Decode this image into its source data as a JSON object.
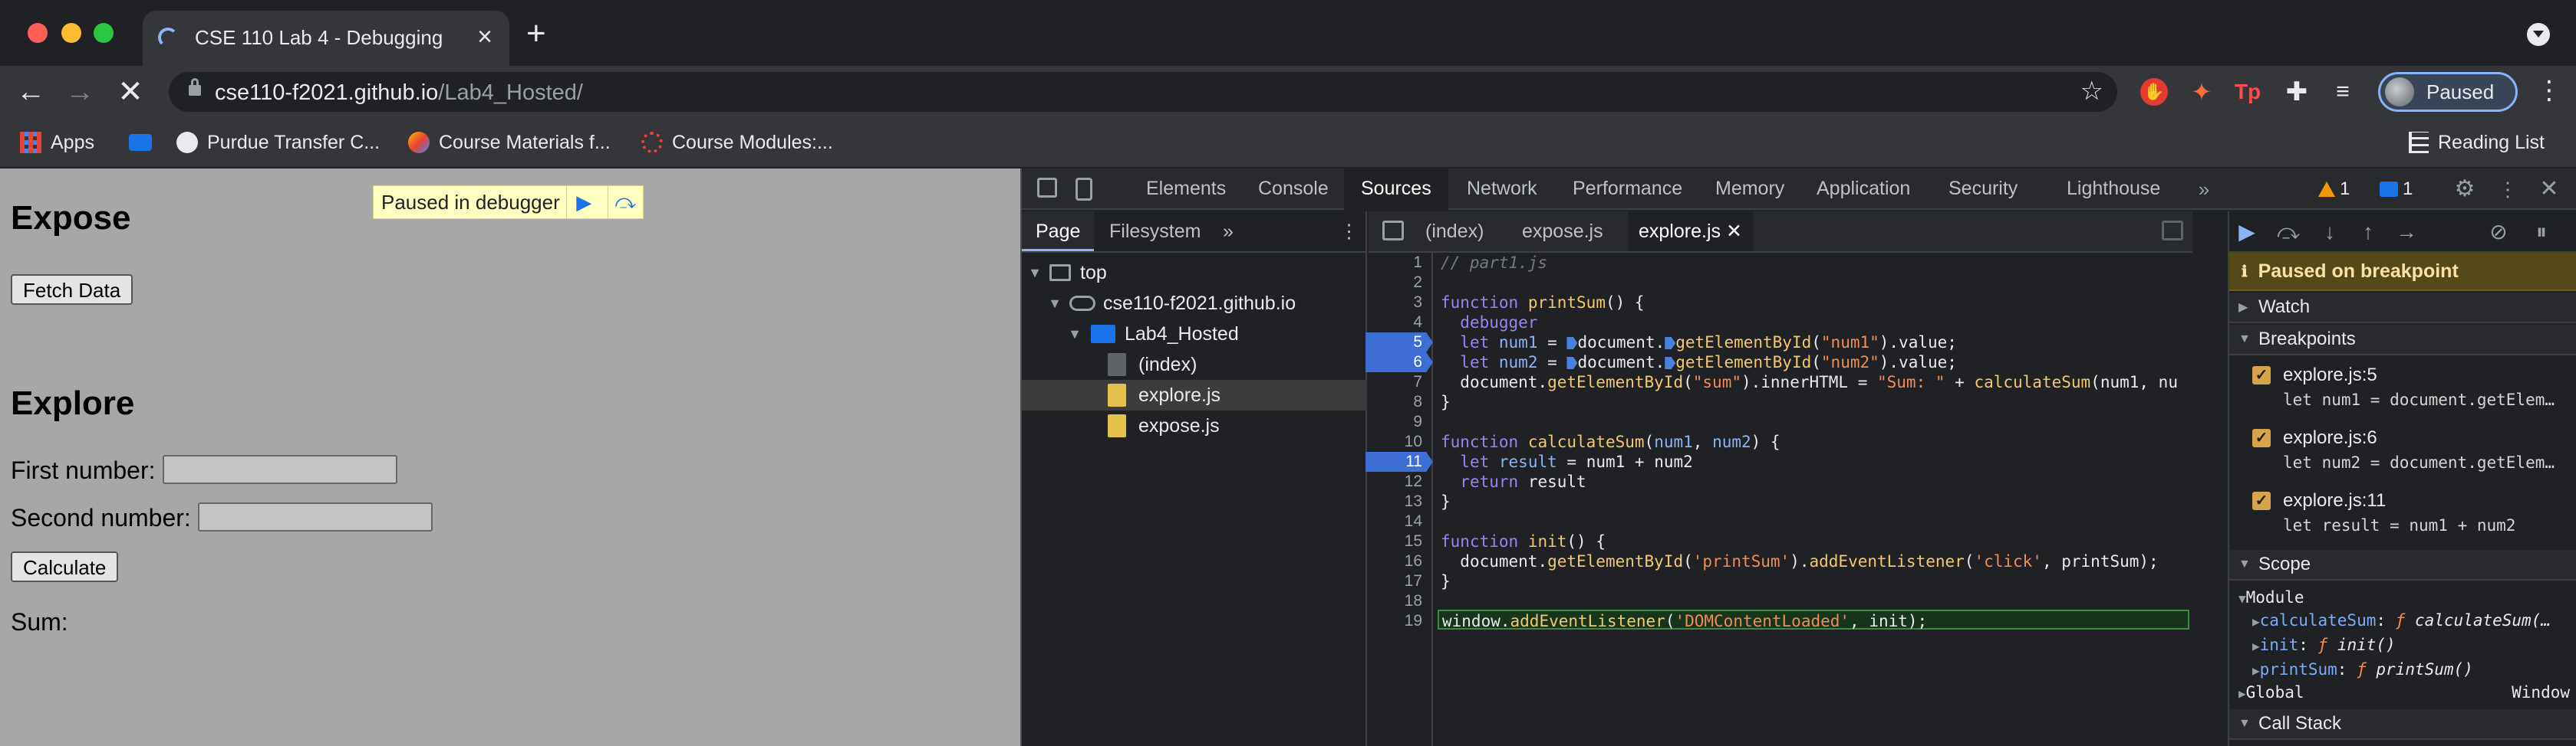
{
  "browser": {
    "tab_title": "CSE 110 Lab 4 - Debugging",
    "url_host": "cse110-f2021.github.io",
    "url_path": "/Lab4_Hosted/",
    "profile_label": "Paused",
    "bookmarks": [
      "Apps",
      "Purdue Transfer C...",
      "Course Materials f...",
      "Course Modules:..."
    ],
    "reading_list": "Reading List"
  },
  "page": {
    "overlay_text": "Paused in debugger",
    "expose_heading": "Expose",
    "fetch_button": "Fetch Data",
    "explore_heading": "Explore",
    "first_label": "First number:",
    "second_label": "Second number:",
    "calculate_button": "Calculate",
    "sum_label": "Sum:"
  },
  "devtools": {
    "tabs": [
      "Elements",
      "Console",
      "Sources",
      "Network",
      "Performance",
      "Memory",
      "Application",
      "Security",
      "Lighthouse"
    ],
    "active_tab": "Sources",
    "warnings_count": "1",
    "messages_count": "1",
    "navigator_tabs": [
      "Page",
      "Filesystem"
    ],
    "tree": {
      "top": "top",
      "host": "cse110-f2021.github.io",
      "folder": "Lab4_Hosted",
      "files": [
        "(index)",
        "explore.js",
        "expose.js"
      ]
    },
    "editor_tabs": [
      "(index)",
      "expose.js",
      "explore.js"
    ],
    "line_numbers": [
      "1",
      "2",
      "3",
      "4",
      "5",
      "6",
      "7",
      "8",
      "9",
      "10",
      "11",
      "12",
      "13",
      "14",
      "15",
      "16",
      "17",
      "18",
      "19"
    ],
    "paused_banner": "Paused on breakpoint",
    "sections": {
      "watch": "Watch",
      "breakpoints": "Breakpoints",
      "scope": "Scope",
      "call_stack": "Call Stack"
    },
    "breakpoints": [
      {
        "file": "explore.js:5",
        "code": "let num1 = document.getElem…"
      },
      {
        "file": "explore.js:6",
        "code": "let num2 = document.getElem…"
      },
      {
        "file": "explore.js:11",
        "code": "let result = num1 + num2"
      }
    ],
    "scope": {
      "module": "Module",
      "items": [
        {
          "key": "calculateSum",
          "sig": "calculateSum(…"
        },
        {
          "key": "init",
          "sig": "init()"
        },
        {
          "key": "printSum",
          "sig": "printSum()"
        }
      ],
      "global": "Global",
      "global_value": "Window"
    }
  }
}
